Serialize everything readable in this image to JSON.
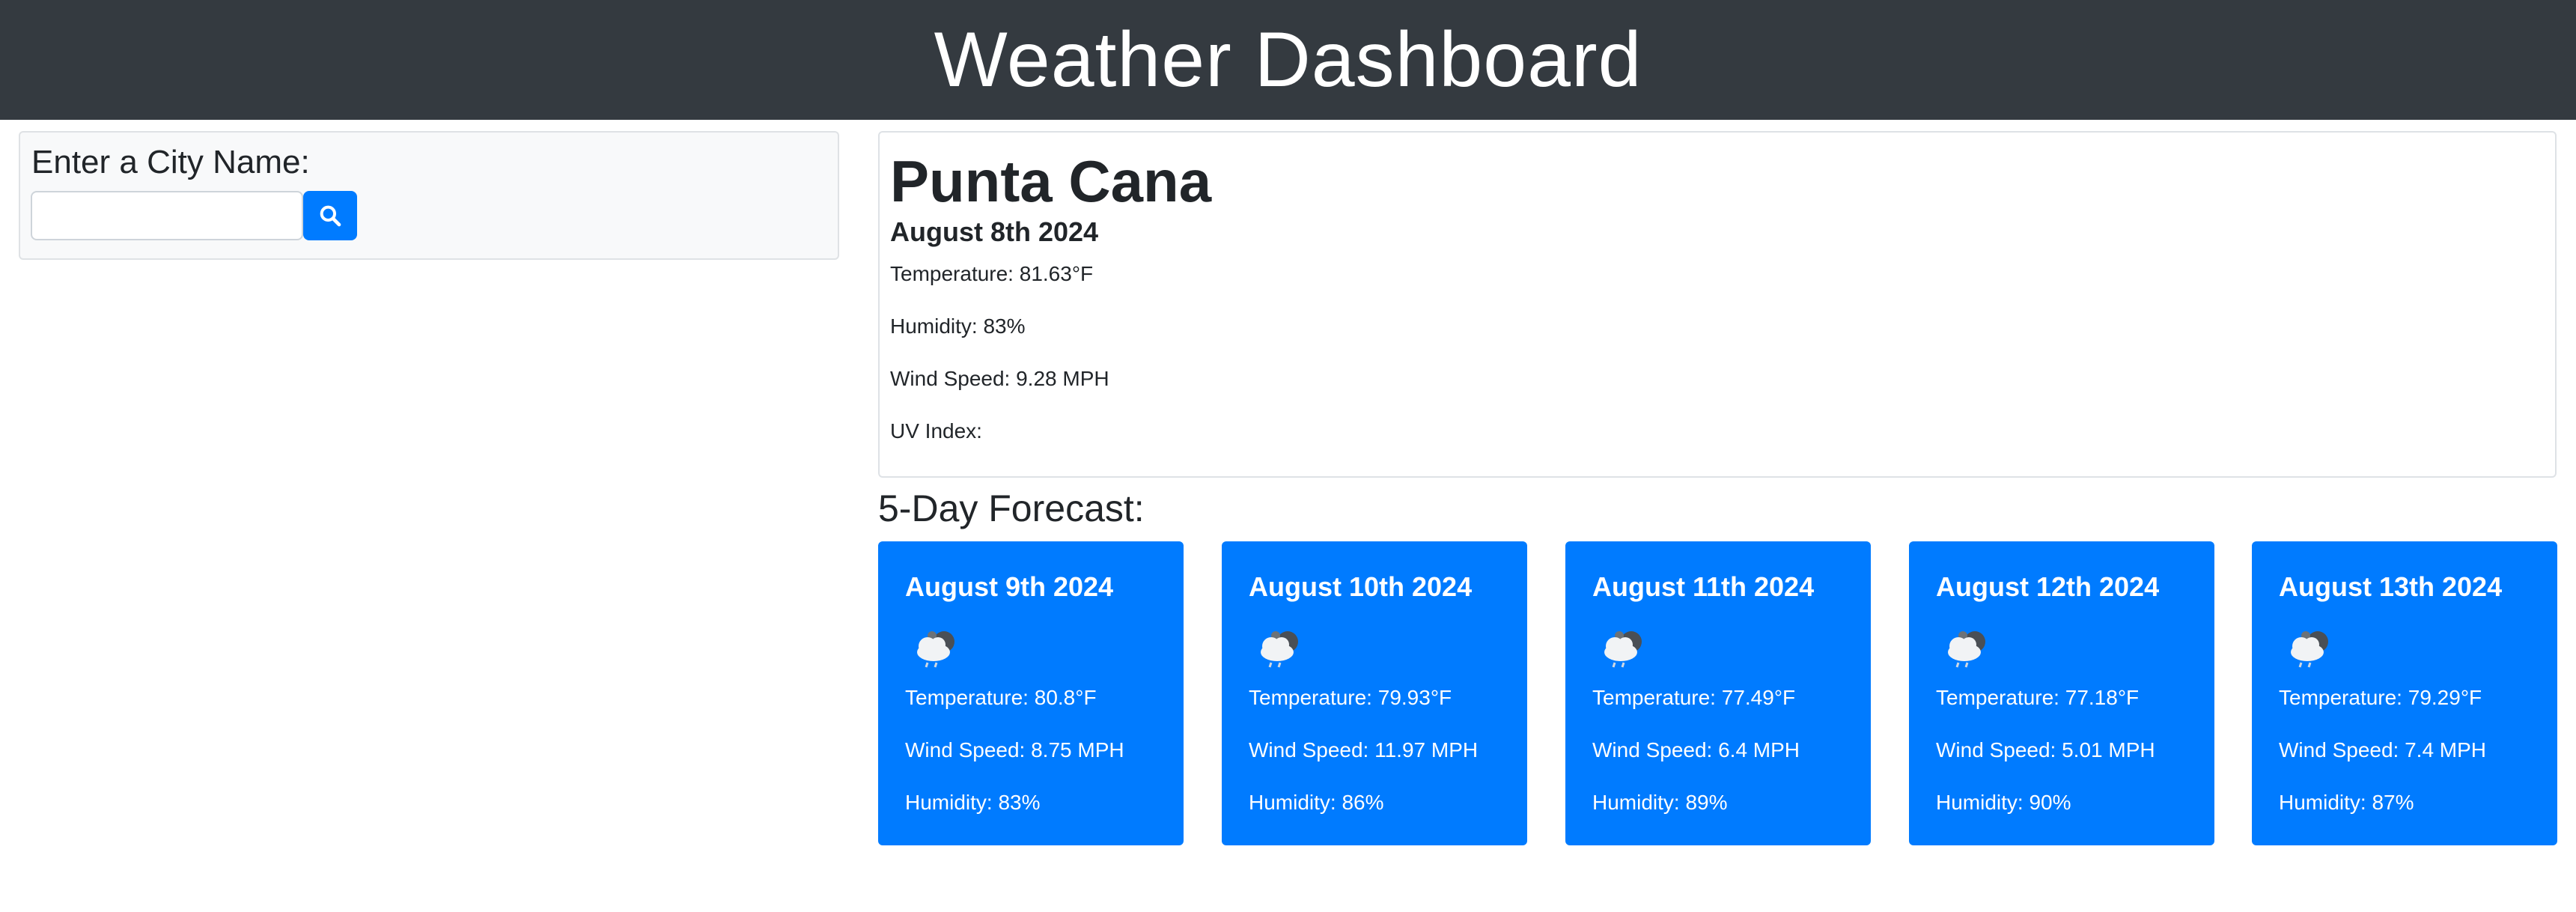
{
  "header": {
    "title": "Weather Dashboard"
  },
  "search": {
    "label": "Enter a City Name:",
    "value": "",
    "placeholder": ""
  },
  "current": {
    "city": "Punta Cana",
    "date": "August 8th 2024",
    "temperature": "Temperature: 81.63°F",
    "humidity": "Humidity: 83%",
    "wind": "Wind Speed: 9.28 MPH",
    "uv": "UV Index:"
  },
  "forecast": {
    "title": "5-Day Forecast:",
    "days": [
      {
        "date": "August 9th 2024",
        "icon": "cloud-rain-icon",
        "temperature": "Temperature: 80.8°F",
        "wind": "Wind Speed: 8.75 MPH",
        "humidity": "Humidity: 83%"
      },
      {
        "date": "August 10th 2024",
        "icon": "cloud-rain-icon",
        "temperature": "Temperature: 79.93°F",
        "wind": "Wind Speed: 11.97 MPH",
        "humidity": "Humidity: 86%"
      },
      {
        "date": "August 11th 2024",
        "icon": "cloud-rain-icon",
        "temperature": "Temperature: 77.49°F",
        "wind": "Wind Speed: 6.4 MPH",
        "humidity": "Humidity: 89%"
      },
      {
        "date": "August 12th 2024",
        "icon": "cloud-rain-icon",
        "temperature": "Temperature: 77.18°F",
        "wind": "Wind Speed: 5.01 MPH",
        "humidity": "Humidity: 90%"
      },
      {
        "date": "August 13th 2024",
        "icon": "cloud-rain-icon",
        "temperature": "Temperature: 79.29°F",
        "wind": "Wind Speed: 7.4 MPH",
        "humidity": "Humidity: 87%"
      }
    ]
  },
  "colors": {
    "header_bg": "#343a40",
    "accent": "#007bff",
    "panel_bg": "#f8f9fa"
  }
}
